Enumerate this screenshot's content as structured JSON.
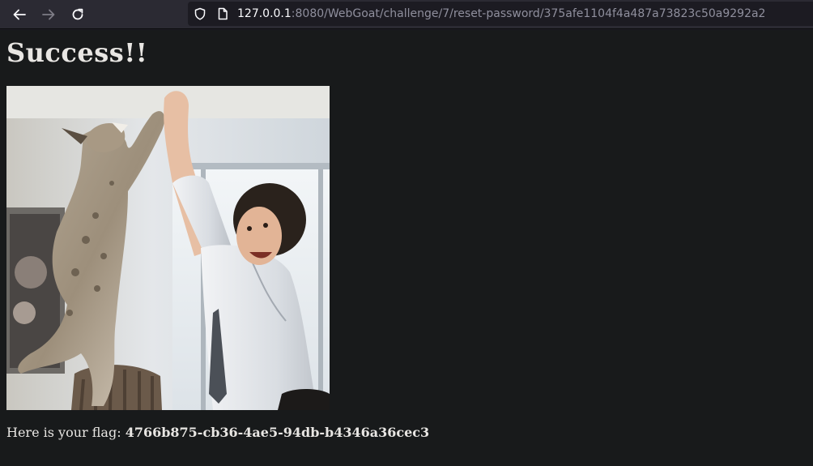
{
  "browser": {
    "url_host": "127.0.0.1",
    "url_rest": ":8080/WebGoat/challenge/7/reset-password/375afe1104f4a487a73823c50a9292a2",
    "icons": [
      "back-arrow-icon",
      "forward-arrow-icon",
      "reload-icon",
      "shield-icon",
      "page-icon"
    ]
  },
  "page": {
    "title": "Success!!",
    "flag_label": "Here is your flag: ",
    "flag_value": "4766b875-cb36-4ae5-94db-b4346a36cec3"
  },
  "colors": {
    "toolbar": "#2b2a33",
    "urlbar": "#1c1b22",
    "page_bg": "#181a1b",
    "text": "#e8e6e3"
  }
}
